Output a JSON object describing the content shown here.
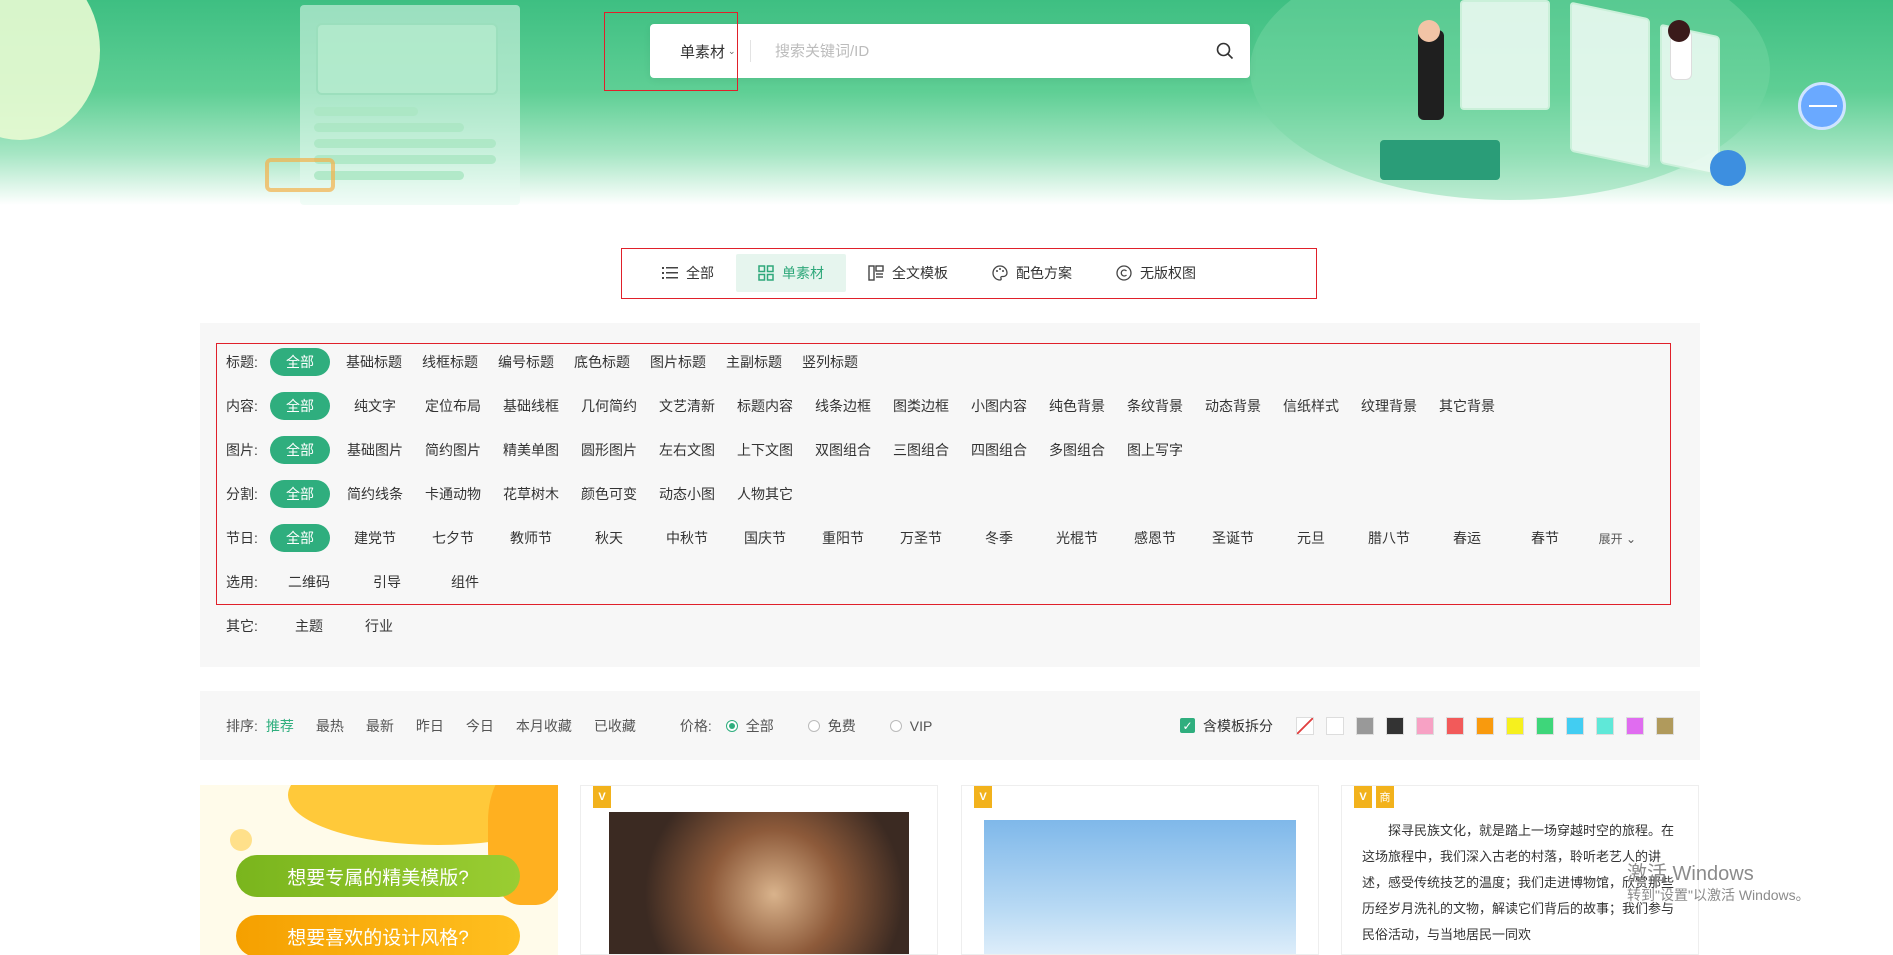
{
  "search": {
    "type_label": "单素材",
    "placeholder": "搜索关键词/ID"
  },
  "tabs": [
    {
      "label": "全部",
      "icon": "list-icon"
    },
    {
      "label": "单素材",
      "icon": "grid-icon"
    },
    {
      "label": "全文模板",
      "icon": "layout-icon"
    },
    {
      "label": "配色方案",
      "icon": "palette-icon"
    },
    {
      "label": "无版权图",
      "icon": "copyright-icon"
    }
  ],
  "filters": {
    "title": {
      "label": "标题:",
      "options": [
        "全部",
        "基础标题",
        "线框标题",
        "编号标题",
        "底色标题",
        "图片标题",
        "主副标题",
        "竖列标题"
      ]
    },
    "content": {
      "label": "内容:",
      "options": [
        "全部",
        "纯文字",
        "定位布局",
        "基础线框",
        "几何简约",
        "文艺清新",
        "标题内容",
        "线条边框",
        "图类边框",
        "小图内容",
        "纯色背景",
        "条纹背景",
        "动态背景",
        "信纸样式",
        "纹理背景",
        "其它背景"
      ]
    },
    "image": {
      "label": "图片:",
      "options": [
        "全部",
        "基础图片",
        "简约图片",
        "精美单图",
        "圆形图片",
        "左右文图",
        "上下文图",
        "双图组合",
        "三图组合",
        "四图组合",
        "多图组合",
        "图上写字"
      ]
    },
    "divider": {
      "label": "分割:",
      "options": [
        "全部",
        "简约线条",
        "卡通动物",
        "花草树木",
        "颜色可变",
        "动态小图",
        "人物其它"
      ]
    },
    "holiday": {
      "label": "节日:",
      "options": [
        "全部",
        "建党节",
        "七夕节",
        "教师节",
        "秋天",
        "中秋节",
        "国庆节",
        "重阳节",
        "万圣节",
        "冬季",
        "光棍节",
        "感恩节",
        "圣诞节",
        "元旦",
        "腊八节",
        "春运",
        "春节"
      ],
      "expand": "展开"
    },
    "select": {
      "label": "选用:",
      "options": [
        "二维码",
        "引导",
        "组件"
      ]
    },
    "other": {
      "label": "其它:",
      "options": [
        "主题",
        "行业"
      ]
    }
  },
  "sort": {
    "label": "排序:",
    "options": [
      "推荐",
      "最热",
      "最新",
      "昨日",
      "今日",
      "本月收藏",
      "已收藏"
    ],
    "price_label": "价格:",
    "price_options": [
      "全部",
      "免费",
      "VIP"
    ],
    "checkbox_label": "含模板拆分",
    "colors": [
      "none",
      "#ffffff",
      "#999999",
      "#333333",
      "#f7a1c4",
      "#f25a5a",
      "#f99a0d",
      "#f6f01e",
      "#3ed67a",
      "#42cdf2",
      "#5fe8d8",
      "#e06cf0",
      "#b09a5c"
    ]
  },
  "cards": {
    "card1": {
      "pill1": "想要专属的精美模版?",
      "pill2": "想要喜欢的设计风格?"
    },
    "card4": {
      "badge": "商",
      "text": "探寻民族文化，就是踏上一场穿越时空的旅程。在这场旅程中，我们深入古老的村落，聆听老艺人的讲述，感受传统技艺的温度；我们走进博物馆，欣赏那些历经岁月洗礼的文物，解读它们背后的故事；我们参与民俗活动，与当地居民一同欢"
    }
  },
  "watermark": {
    "line1": "激活 Windows",
    "line2": "转到\"设置\"以激活 Windows。"
  }
}
